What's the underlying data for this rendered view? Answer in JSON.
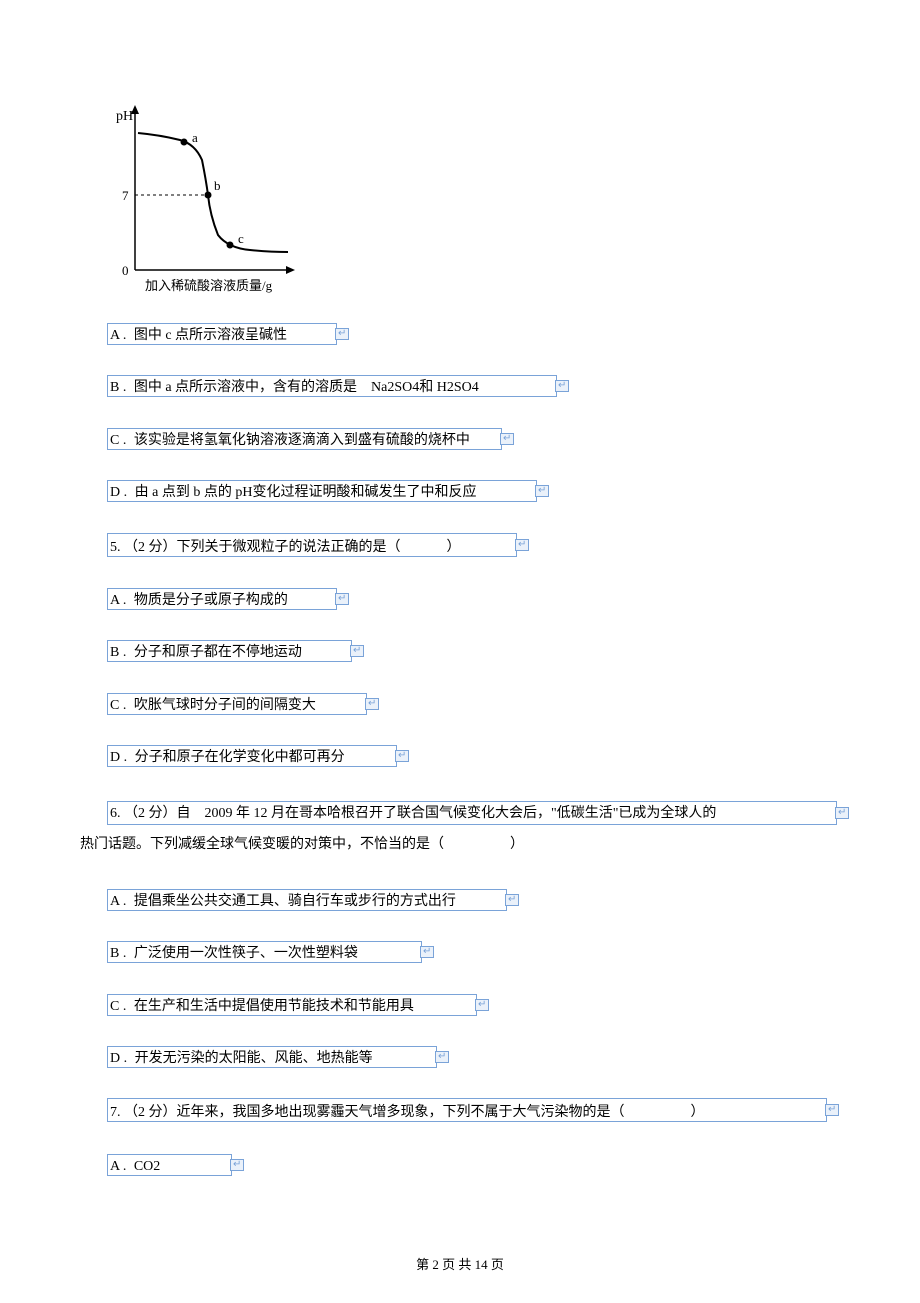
{
  "chart_data": {
    "type": "line",
    "title": "",
    "xlabel": "加入稀硫酸溶液质量/g",
    "ylabel": "pH",
    "xlim": [
      0,
      10
    ],
    "ylim": [
      0,
      14
    ],
    "y_reference": 7,
    "points": [
      {
        "label": "a",
        "x": 2.5,
        "y": 12
      },
      {
        "label": "b",
        "x": 4.2,
        "y": 7
      },
      {
        "label": "c",
        "x": 6.0,
        "y": 2.5
      }
    ],
    "series": [
      {
        "name": "pH curve",
        "x": [
          0,
          1,
          2,
          2.5,
          3,
          3.5,
          3.8,
          4.0,
          4.2,
          4.4,
          4.6,
          5,
          6,
          8,
          10
        ],
        "y": [
          13,
          12.8,
          12.5,
          12,
          11,
          9.5,
          8.5,
          7.8,
          7,
          5.5,
          4.2,
          3,
          2.5,
          2.2,
          2.1
        ]
      }
    ]
  },
  "q4": {
    "optionA": {
      "letter": "A .",
      "text": "图中 c 点所示溶液呈碱性"
    },
    "optionB": {
      "letter": "B .",
      "text": "图中 a 点所示溶液中，含有的溶质是　Na2SO4和 H2SO4"
    },
    "optionC": {
      "letter": "C .",
      "text": "该实验是将氢氧化钠溶液逐滴滴入到盛有硫酸的烧杯中"
    },
    "optionD": {
      "letter": "D .",
      "text": "由 a 点到 b 点的 pH变化过程证明酸和碱发生了中和反应"
    }
  },
  "q5": {
    "stem_num": "5.",
    "stem": "（2 分）下列关于微观粒子的说法正确的是（",
    "stem_close": "）",
    "optionA": {
      "letter": "A .",
      "text": "物质是分子或原子构成的"
    },
    "optionB": {
      "letter": "B .",
      "text": "分子和原子都在不停地运动"
    },
    "optionC": {
      "letter": "C .",
      "text": "吹胀气球时分子间的间隔变大"
    },
    "optionD": {
      "letter": "D .",
      "text": "分子和原子在化学变化中都可再分"
    }
  },
  "q6": {
    "stem_num": "6.",
    "stem_part1": "（2 分）自　2009 年 12 月在哥本哈根召开了联合国气候变化大会后，\"低碳生活\"已成为全球人的",
    "stem_part2": "热门话题。下列减缓全球气候变暖的对策中，不恰当的是（",
    "stem_close": "）",
    "optionA": {
      "letter": "A .",
      "text": "提倡乘坐公共交通工具、骑自行车或步行的方式出行"
    },
    "optionB": {
      "letter": "B .",
      "text": "广泛使用一次性筷子、一次性塑料袋"
    },
    "optionC": {
      "letter": "C .",
      "text": "在生产和生活中提倡使用节能技术和节能用具"
    },
    "optionD": {
      "letter": "D .",
      "text": "开发无污染的太阳能、风能、地热能等"
    }
  },
  "q7": {
    "stem_num": "7.",
    "stem": "（2 分）近年来，我国多地出现雾霾天气增多现象，下列不属于大气污染物的是（",
    "stem_close": "）",
    "optionA": {
      "letter": "A .",
      "text": "CO2"
    }
  },
  "footer": "第 2 页 共 14 页",
  "annotations": {
    "para": "↵"
  }
}
